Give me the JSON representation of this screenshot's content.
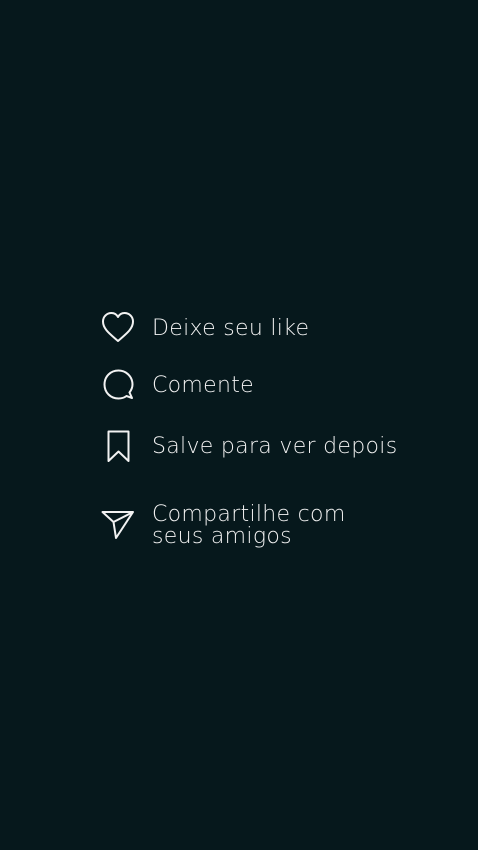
{
  "actions": [
    {
      "id": "like",
      "icon": "heart-icon",
      "label": "Deixe seu like"
    },
    {
      "id": "comment",
      "icon": "speech-bubble-icon",
      "label": "Comente"
    },
    {
      "id": "save",
      "icon": "bookmark-icon",
      "label": "Salve para ver depois"
    },
    {
      "id": "share",
      "icon": "paper-plane-icon",
      "label_line1": "Compartilhe com",
      "label_line2": "seus amigos"
    }
  ],
  "colors": {
    "background": "#06181c",
    "foreground": "#f2f2f2"
  }
}
